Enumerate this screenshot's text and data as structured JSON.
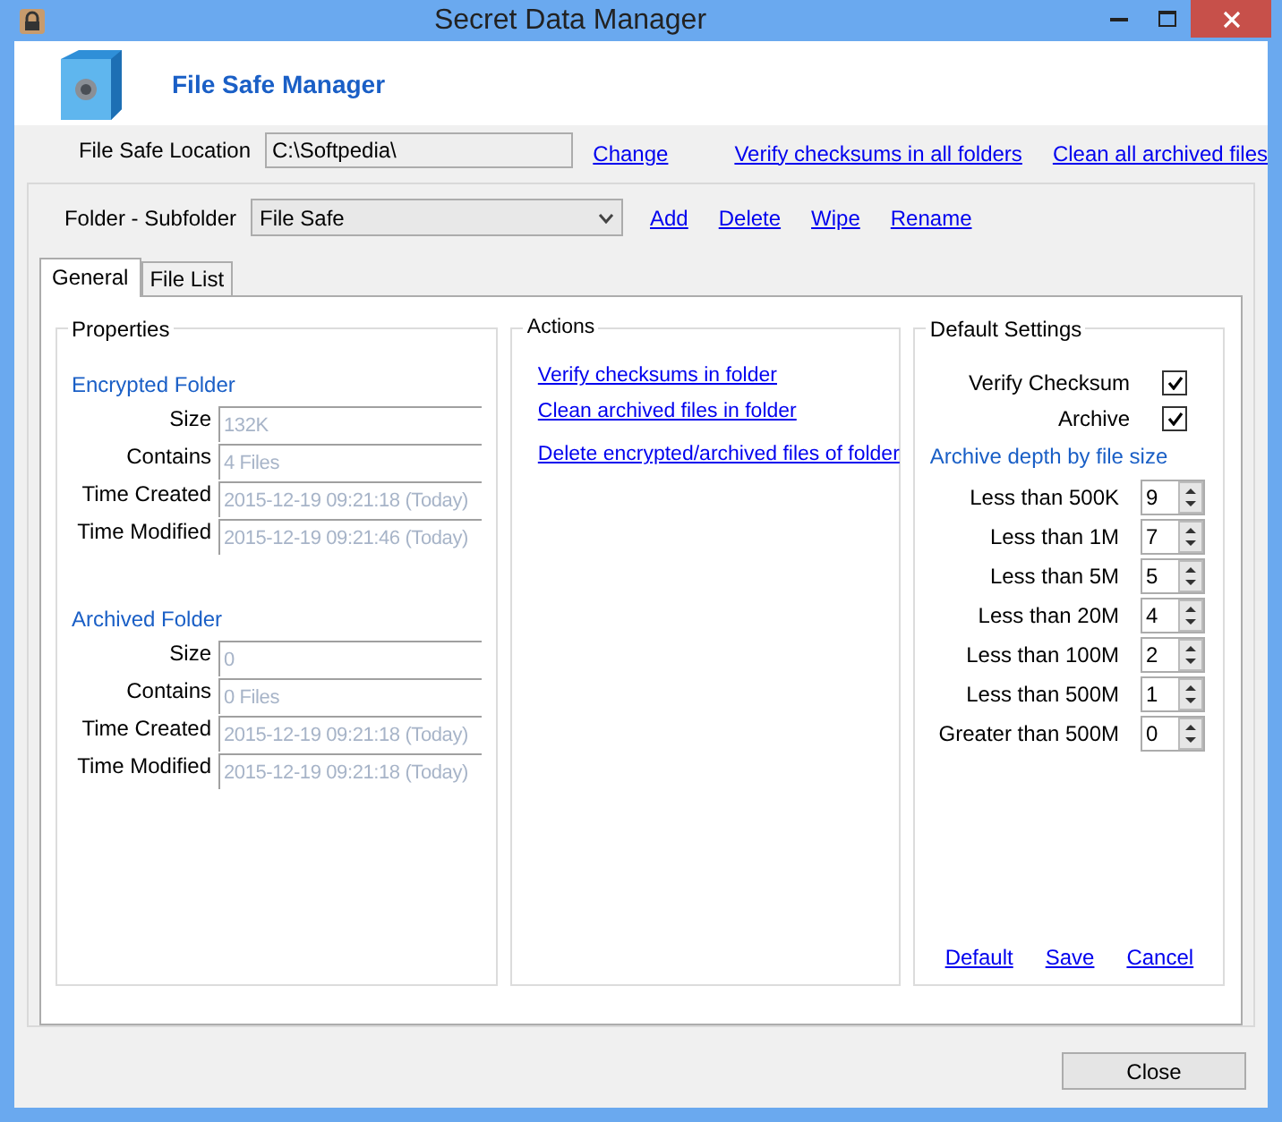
{
  "window": {
    "title": "Secret Data Manager"
  },
  "header": {
    "title": "File Safe Manager"
  },
  "location": {
    "label": "File Safe Location",
    "value": "C:\\Softpedia\\"
  },
  "location_links": [
    "Change",
    "Verify checksums in all folders",
    "Clean all archived files"
  ],
  "folder": {
    "label": "Folder - Subfolder",
    "value": "File Safe"
  },
  "folder_links": [
    "Add",
    "Delete",
    "Wipe",
    "Rename"
  ],
  "tabs": [
    {
      "label": "General",
      "selected": true
    },
    {
      "label": "File List",
      "selected": false
    }
  ],
  "properties": {
    "title": "Properties",
    "sections": [
      {
        "heading": "Encrypted Folder",
        "fields": [
          {
            "label": "Size",
            "value": "132K"
          },
          {
            "label": "Contains",
            "value": "4 Files"
          },
          {
            "label": "Time Created",
            "value": "2015-12-19 09:21:18 (Today)"
          },
          {
            "label": "Time Modified",
            "value": "2015-12-19 09:21:46 (Today)"
          }
        ]
      },
      {
        "heading": "Archived Folder",
        "fields": [
          {
            "label": "Size",
            "value": "0"
          },
          {
            "label": "Contains",
            "value": "0 Files"
          },
          {
            "label": "Time Created",
            "value": "2015-12-19 09:21:18 (Today)"
          },
          {
            "label": "Time Modified",
            "value": "2015-12-19 09:21:18 (Today)"
          }
        ]
      }
    ]
  },
  "actions": {
    "title": "Actions",
    "links": [
      "Verify checksums in folder",
      "Clean archived files in folder",
      "Delete encrypted/archived files of folder"
    ]
  },
  "settings": {
    "title": "Default Settings",
    "checks": [
      {
        "label": "Verify Checksum",
        "checked": true
      },
      {
        "label": "Archive",
        "checked": true
      }
    ],
    "depth_heading": "Archive depth by file size",
    "depths": [
      {
        "label": "Less than 500K",
        "value": "9"
      },
      {
        "label": "Less than 1M",
        "value": "7"
      },
      {
        "label": "Less than 5M",
        "value": "5"
      },
      {
        "label": "Less than 20M",
        "value": "4"
      },
      {
        "label": "Less than 100M",
        "value": "2"
      },
      {
        "label": "Less than 500M",
        "value": "1"
      },
      {
        "label": "Greater than 500M",
        "value": "0"
      }
    ],
    "links": [
      "Default",
      "Save",
      "Cancel"
    ]
  },
  "buttons": [
    "Close"
  ]
}
